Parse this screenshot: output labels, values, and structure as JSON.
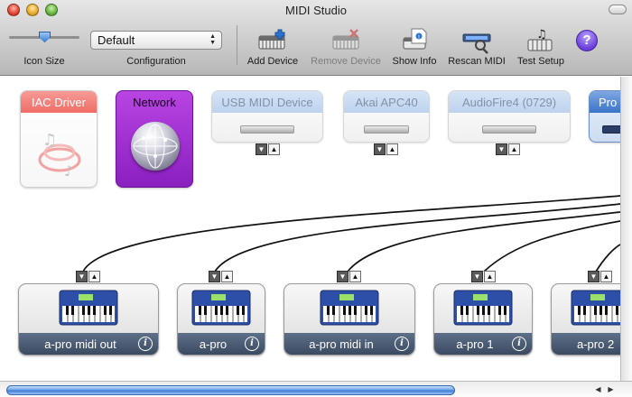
{
  "window": {
    "title": "MIDI Studio"
  },
  "toolbar": {
    "icon_size_label": "Icon Size",
    "icon_size_value": 0.5,
    "configuration_label": "Configuration",
    "configuration_value": "Default",
    "add_device_label": "Add Device",
    "remove_device_label": "Remove Device",
    "show_info_label": "Show Info",
    "rescan_label": "Rescan MIDI",
    "test_setup_label": "Test Setup",
    "help_label": "?"
  },
  "devices": {
    "iac": "IAC Driver",
    "network": "Network",
    "usb": "USB MIDI Device",
    "akai": "Akai APC40",
    "audiofire": "AudioFire4 (0729)",
    "pro": "Pro"
  },
  "ports_glyphs": {
    "in": "▼",
    "out": "▲"
  },
  "info_glyph": "i",
  "external": [
    {
      "name": "a-pro midi out"
    },
    {
      "name": "a-pro"
    },
    {
      "name": "a-pro midi in"
    },
    {
      "name": "a-pro 1"
    },
    {
      "name": "a-pro 2"
    }
  ],
  "scroll": {
    "horizontal_position": 0,
    "horizontal_visible_fraction": 0.72,
    "left_arrow": "◀",
    "right_arrow": "▶"
  },
  "colors": {
    "iac_header": "#ef6d66",
    "network": "#9b2fd0",
    "selection_blue": "#3c7ad5",
    "device_bar": "#4a5b73"
  }
}
